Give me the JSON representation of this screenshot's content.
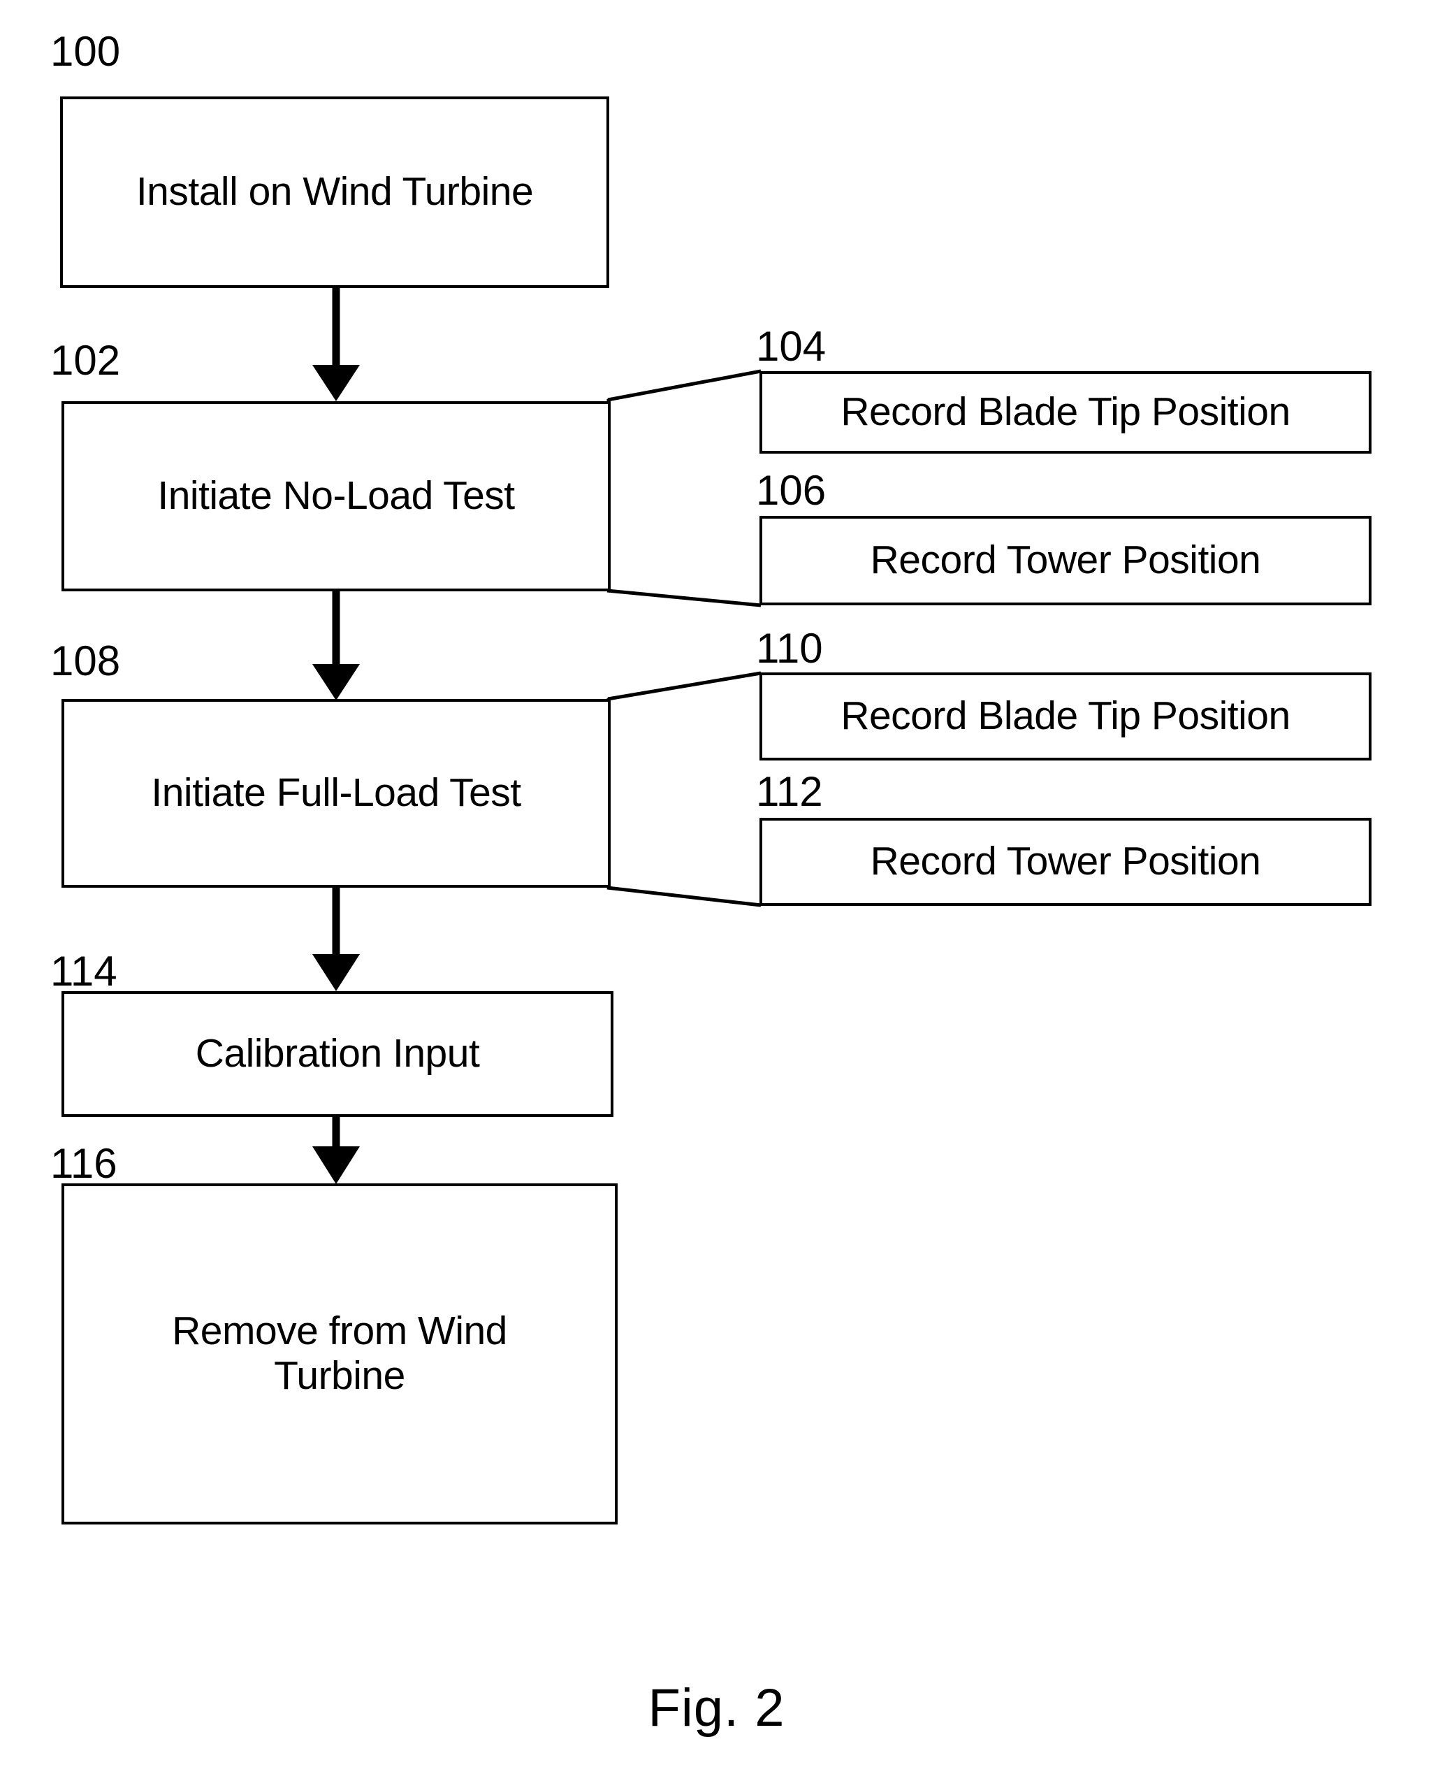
{
  "figure": {
    "caption": "Fig. 2",
    "nodes": [
      {
        "ref": "100",
        "label": "Install on Wind Turbine",
        "kind": "main"
      },
      {
        "ref": "102",
        "label": "Initiate No-Load Test",
        "kind": "main"
      },
      {
        "ref": "104",
        "label": "Record Blade Tip Position",
        "kind": "branch"
      },
      {
        "ref": "106",
        "label": "Record Tower Position",
        "kind": "branch"
      },
      {
        "ref": "108",
        "label": "Initiate Full-Load Test",
        "kind": "main"
      },
      {
        "ref": "110",
        "label": "Record Blade Tip Position",
        "kind": "branch"
      },
      {
        "ref": "112",
        "label": "Record Tower Position",
        "kind": "branch"
      },
      {
        "ref": "114",
        "label": "Calibration Input",
        "kind": "main"
      },
      {
        "ref": "116",
        "label": "Remove from Wind\nTurbine",
        "kind": "main"
      }
    ],
    "flow_sequence": [
      "100",
      "102",
      "108",
      "114",
      "116"
    ],
    "branches": [
      {
        "from": "102",
        "to": [
          "104",
          "106"
        ]
      },
      {
        "from": "108",
        "to": [
          "110",
          "112"
        ]
      }
    ],
    "colors": {
      "stroke": "#000000",
      "background": "#ffffff",
      "text": "#000000"
    }
  }
}
